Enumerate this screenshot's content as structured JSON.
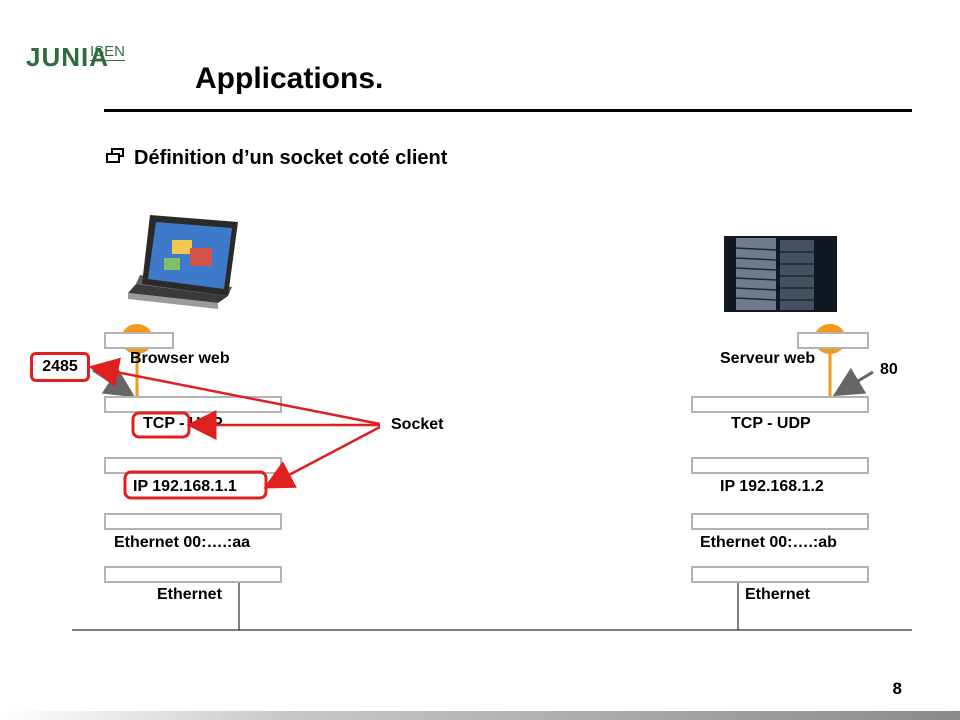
{
  "slide": {
    "logo": {
      "brand": "JUNIA",
      "sub": "ISEN"
    },
    "title": "Applications.",
    "bullet": "Définition d’un socket coté client",
    "page_number": "8"
  },
  "client": {
    "layers": [
      "Browser web",
      "TCP - UDP",
      "IP 192.168.1.1",
      "Ethernet 00:….:aa",
      "Ethernet"
    ],
    "port": "2485"
  },
  "server": {
    "layers": [
      "Serveur web",
      "TCP - UDP",
      "IP 192.168.1.2",
      "Ethernet 00:….:ab",
      "Ethernet"
    ],
    "port": "80"
  },
  "socket_label": "Socket",
  "colors": {
    "accent": "#e02020",
    "endpoint": "#f39a1e",
    "brand": "#2f6b3d",
    "box_border": "#b3b3b3"
  },
  "icons": {
    "client": "laptop-icon",
    "server": "server-rack-icon",
    "bullet": "window-icon"
  }
}
